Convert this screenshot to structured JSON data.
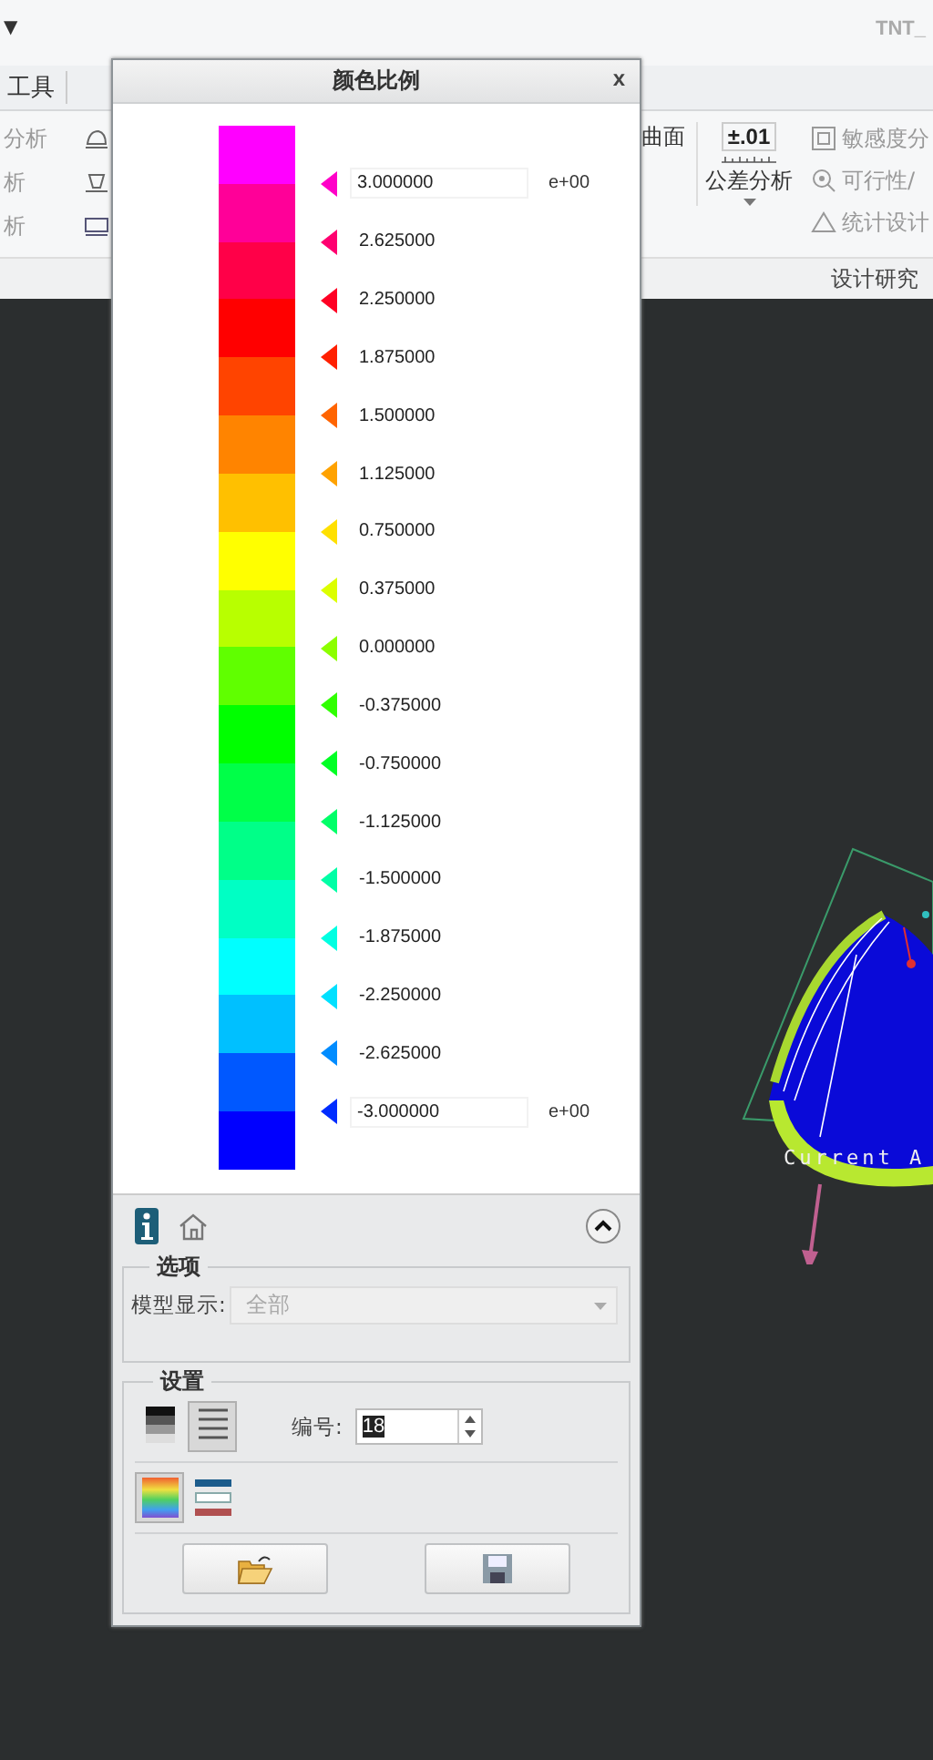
{
  "app": {
    "title": "TNT_",
    "quick_access": "▼"
  },
  "ribbon": {
    "tab": "工具",
    "left_commands": [
      {
        "label": "分析"
      },
      {
        "label": "析"
      },
      {
        "label": "析"
      }
    ],
    "right": {
      "surface_label": "曲面",
      "tolerance": {
        "value": "±.01",
        "label": "公差分析"
      },
      "study_commands": [
        {
          "label": "敏感度分"
        },
        {
          "label": "可行性/"
        },
        {
          "label": "统计设计"
        }
      ],
      "group_label": "设计研究"
    }
  },
  "viewport": {
    "label": "Current A"
  },
  "dialog": {
    "title": "颜色比例",
    "close": "x",
    "bands": [
      {
        "color": "#ff00ff"
      },
      {
        "color": "#ff0098"
      },
      {
        "color": "#ff0048"
      },
      {
        "color": "#ff0000"
      },
      {
        "color": "#ff4400"
      },
      {
        "color": "#ff8400"
      },
      {
        "color": "#ffc000"
      },
      {
        "color": "#ffff00"
      },
      {
        "color": "#b8ff00"
      },
      {
        "color": "#60ff00"
      },
      {
        "color": "#00ff00"
      },
      {
        "color": "#00ff48"
      },
      {
        "color": "#00ff88"
      },
      {
        "color": "#00ffc4"
      },
      {
        "color": "#00ffff"
      },
      {
        "color": "#00c0ff"
      },
      {
        "color": "#0058ff"
      },
      {
        "color": "#0000ff"
      }
    ],
    "ticks": [
      {
        "value": "3.000000",
        "kind": "edit",
        "exponent": "e+00",
        "color": "#ff00c8"
      },
      {
        "value": "2.625000",
        "kind": "plain",
        "color": "#ff0070"
      },
      {
        "value": "2.250000",
        "kind": "plain",
        "color": "#ff0024"
      },
      {
        "value": "1.875000",
        "kind": "plain",
        "color": "#ff2000"
      },
      {
        "value": "1.500000",
        "kind": "plain",
        "color": "#ff6400"
      },
      {
        "value": "1.125000",
        "kind": "plain",
        "color": "#ffa200"
      },
      {
        "value": "0.750000",
        "kind": "plain",
        "color": "#ffe000"
      },
      {
        "value": "0.375000",
        "kind": "plain",
        "color": "#dcff00"
      },
      {
        "value": "0.000000",
        "kind": "plain",
        "color": "#8cff00"
      },
      {
        "value": "-0.375000",
        "kind": "plain",
        "color": "#30ff00"
      },
      {
        "value": "-0.750000",
        "kind": "plain",
        "color": "#00ff24"
      },
      {
        "value": "-1.125000",
        "kind": "plain",
        "color": "#00ff68"
      },
      {
        "value": "-1.500000",
        "kind": "plain",
        "color": "#00ffa6"
      },
      {
        "value": "-1.875000",
        "kind": "plain",
        "color": "#00ffe2"
      },
      {
        "value": "-2.250000",
        "kind": "plain",
        "color": "#00e0ff"
      },
      {
        "value": "-2.625000",
        "kind": "plain",
        "color": "#008cff"
      },
      {
        "value": "-3.000000",
        "kind": "edit",
        "exponent": "e+00",
        "color": "#002cff"
      }
    ],
    "options": {
      "legend": "选项",
      "display_label": "模型显示:",
      "display_value": "全部",
      "disabled": true
    },
    "settings": {
      "legend": "设置",
      "modes": [
        {
          "kind": "gradient",
          "selected": false
        },
        {
          "kind": "lines",
          "selected": true
        }
      ],
      "count_label": "编号:",
      "count_value": "18",
      "palettes": [
        {
          "kind": "rainbow",
          "selected": true
        },
        {
          "kind": "stripes",
          "selected": false
        }
      ],
      "buttons": [
        {
          "kind": "open"
        },
        {
          "kind": "save"
        }
      ]
    }
  }
}
